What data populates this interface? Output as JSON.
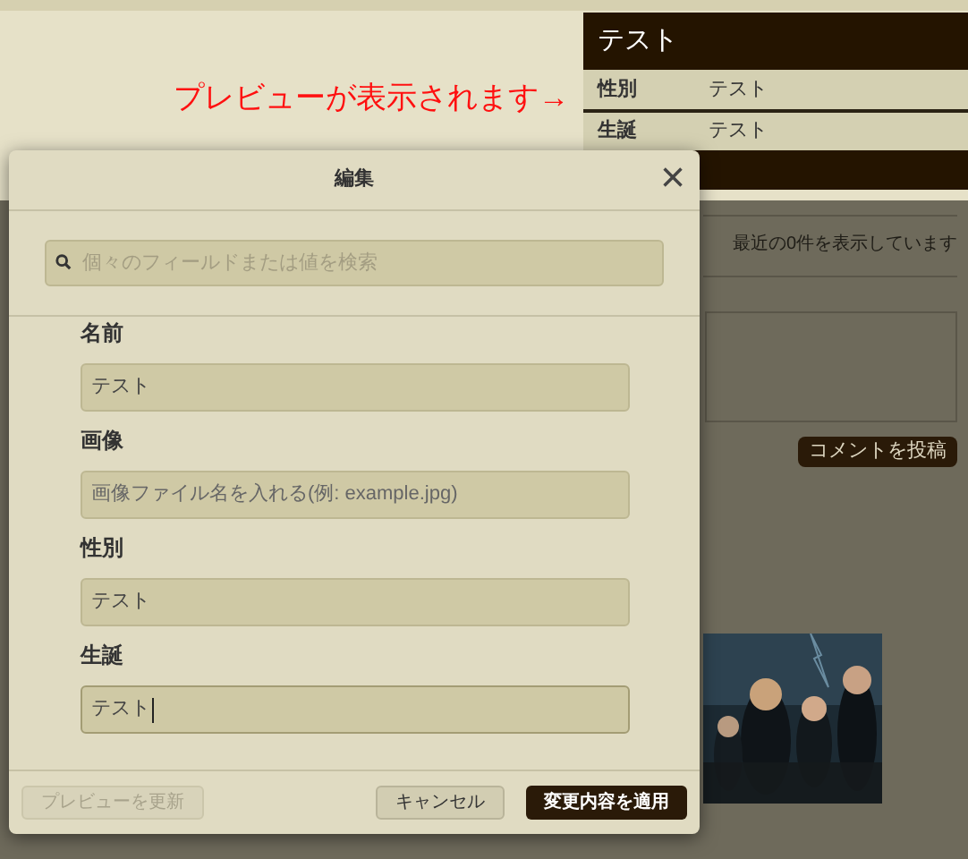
{
  "page": {
    "preview_note": "プレビューが表示されます→",
    "infobox": {
      "title": "テスト",
      "rows": [
        {
          "label": "性別",
          "value": "テスト"
        },
        {
          "label": "生誕",
          "value": "テスト"
        }
      ]
    },
    "recent_count": "最近の0件を表示しています",
    "post_comment_button": "コメントを投稿"
  },
  "dialog": {
    "title": "編集",
    "close": "×",
    "search": {
      "placeholder": "個々のフィールドまたは値を検索"
    },
    "fields": [
      {
        "label": "名前",
        "value": "テスト",
        "focused": false
      },
      {
        "label": "画像",
        "placeholder": "画像ファイル名を入れる(例: example.jpg)",
        "focused": false
      },
      {
        "label": "性別",
        "value": "テスト",
        "focused": false
      },
      {
        "label": "生誕",
        "value": "テスト",
        "focused": true
      }
    ],
    "buttons": [
      {
        "label": "プレビューを更新",
        "kind": "secondary",
        "disabled": true
      },
      {
        "label": "キャンセル",
        "kind": "secondary",
        "disabled": false
      },
      {
        "label": "変更内容を適用",
        "kind": "primary",
        "disabled": false
      }
    ]
  }
}
